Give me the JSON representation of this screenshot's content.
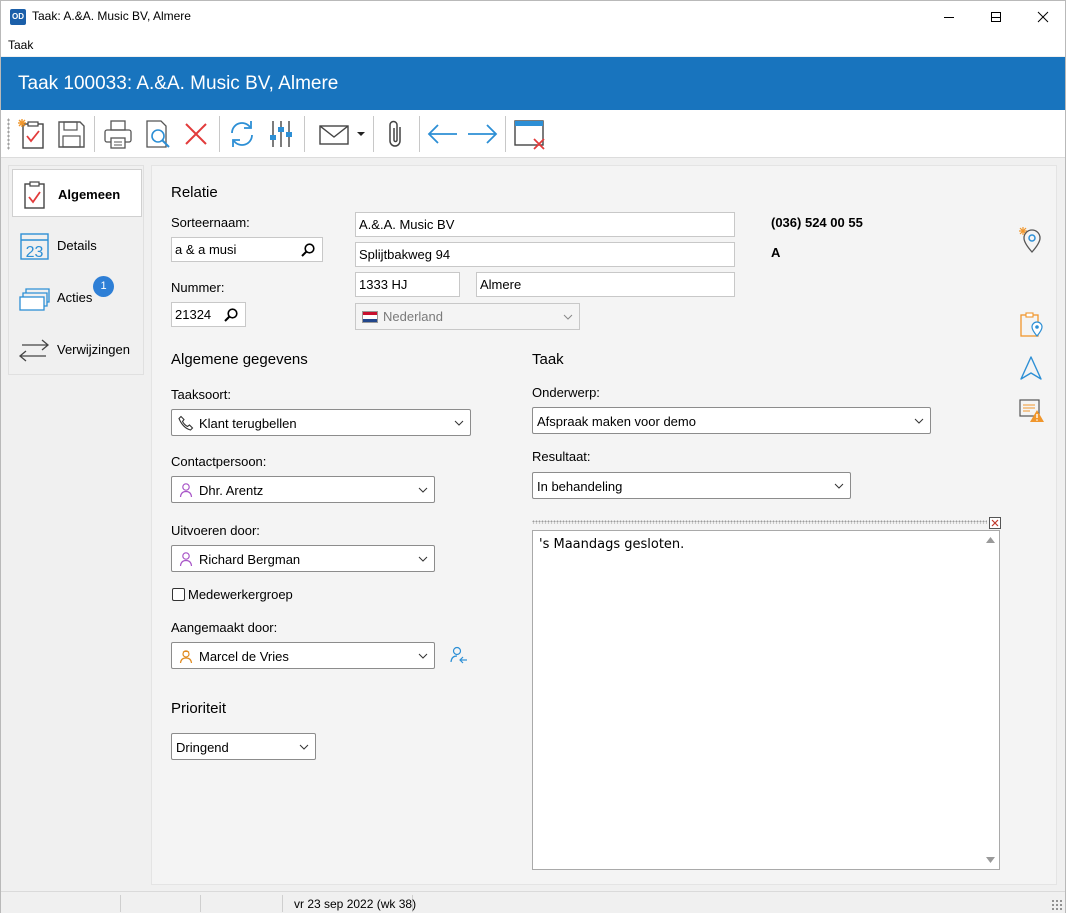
{
  "window": {
    "title": "Taak: A.&A. Music BV, Almere",
    "app_badge": "OD"
  },
  "menu": {
    "items": [
      "Taak"
    ]
  },
  "header": {
    "title": "Taak 100033: A.&A. Music BV, Almere"
  },
  "toolbar": {
    "buttons": [
      "new-task-icon",
      "save-icon",
      "print-icon",
      "print-preview-icon",
      "delete-icon",
      "refresh-icon",
      "settings-sliders-icon",
      "mail-icon",
      "attachment-icon",
      "previous-arrow-icon",
      "next-arrow-icon",
      "close-window-icon"
    ]
  },
  "nav": {
    "items": [
      {
        "label": "Algemeen",
        "icon": "clipboard-check-icon",
        "active": true
      },
      {
        "label": "Details",
        "icon": "calendar-icon",
        "active": false
      },
      {
        "label": "Acties",
        "icon": "stack-icon",
        "active": false,
        "badge": "1"
      },
      {
        "label": "Verwijzingen",
        "icon": "swap-arrows-icon",
        "active": false
      }
    ]
  },
  "relatie": {
    "section_title": "Relatie",
    "sorteernaam_label": "Sorteernaam:",
    "sorteernaam_value": "a & a musi",
    "nummer_label": "Nummer:",
    "nummer_value": "21324",
    "name": "A.&.A. Music BV",
    "street": "Splijtbakweg 94",
    "postcode": "1333 HJ",
    "city": "Almere",
    "country": "Nederland",
    "phone": "(036) 524 00 55",
    "code": "A"
  },
  "algemeen": {
    "section_title": "Algemene gegevens",
    "taaksoort_label": "Taaksoort:",
    "taaksoort_value": "Klant terugbellen",
    "contact_label": "Contactpersoon:",
    "contact_value": "Dhr. Arentz",
    "uitvoeren_label": "Uitvoeren door:",
    "uitvoeren_value": "Richard Bergman",
    "medewerkergroep_label": "Medewerkergroep",
    "medewerkergroep_checked": false,
    "aangemaakt_label": "Aangemaakt door:",
    "aangemaakt_value": "Marcel de Vries"
  },
  "prioriteit": {
    "section_title": "Prioriteit",
    "value": "Dringend"
  },
  "taak": {
    "section_title": "Taak",
    "onderwerp_label": "Onderwerp:",
    "onderwerp_value": "Afspraak maken voor demo",
    "resultaat_label": "Resultaat:",
    "resultaat_value": "In behandeling",
    "memo_text": "'s Maandags gesloten."
  },
  "statusbar": {
    "date": "vr 23 sep 2022 (wk 38)"
  },
  "colors": {
    "header_blue": "#1874be",
    "badge_blue": "#2e7fd6",
    "icon_blue": "#2d8fd5",
    "icon_red": "#e23b3b",
    "icon_orange": "#f0962c"
  }
}
